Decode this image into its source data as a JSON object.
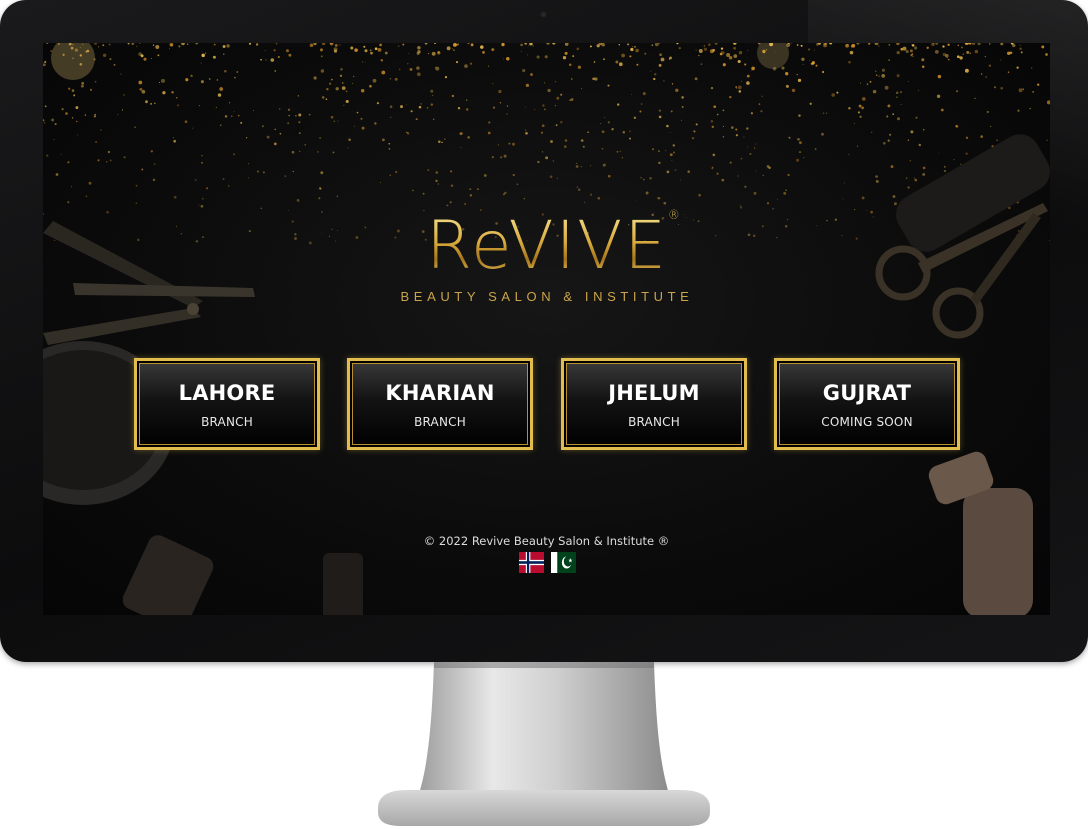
{
  "brand": {
    "name": "Revive",
    "name_display": "ReVIVE",
    "registered_mark": "®",
    "tagline": "BEAUTY SALON & INSTITUTE"
  },
  "branches": [
    {
      "city": "LAHORE",
      "subtitle": "BRANCH"
    },
    {
      "city": "KHARIAN",
      "subtitle": "BRANCH"
    },
    {
      "city": "JHELUM",
      "subtitle": "BRANCH"
    },
    {
      "city": "GUJRAT",
      "subtitle": "COMING SOON"
    }
  ],
  "footer": {
    "copyright": "© 2022 Revive Beauty Salon & Institute ®"
  },
  "flags": [
    {
      "icon": "norway-flag-icon"
    },
    {
      "icon": "pakistan-flag-icon"
    }
  ],
  "colors": {
    "gold": "#e2bd4d",
    "background": "#0b0b0b",
    "bezel": "#111113"
  }
}
